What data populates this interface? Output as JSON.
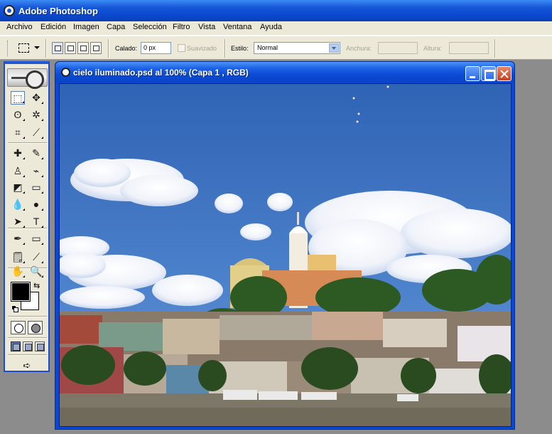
{
  "app": {
    "title": "Adobe Photoshop"
  },
  "menu": {
    "items": [
      "Archivo",
      "Edición",
      "Imagen",
      "Capa",
      "Selección",
      "Filtro",
      "Vista",
      "Ventana",
      "Ayuda"
    ]
  },
  "options": {
    "feather_label": "Calado:",
    "feather_value": "0 px",
    "antialias_label": "Suavizado",
    "style_label": "Estilo:",
    "style_value": "Normal",
    "width_label": "Anchura:",
    "height_label": "Altura:"
  },
  "toolbox": {
    "tools": [
      {
        "name": "rectangular-marquee-tool",
        "glyph": "⬚",
        "selected": true
      },
      {
        "name": "move-tool",
        "glyph": "✥"
      },
      {
        "name": "lasso-tool",
        "glyph": "ʘ"
      },
      {
        "name": "magic-wand-tool",
        "glyph": "✲"
      },
      {
        "name": "crop-tool",
        "glyph": "⌗"
      },
      {
        "name": "slice-tool",
        "glyph": "⟋"
      },
      {
        "name": "healing-brush-tool",
        "glyph": "✚"
      },
      {
        "name": "brush-tool",
        "glyph": "✎"
      },
      {
        "name": "clone-stamp-tool",
        "glyph": "♙"
      },
      {
        "name": "history-brush-tool",
        "glyph": "⌁"
      },
      {
        "name": "eraser-tool",
        "glyph": "◩"
      },
      {
        "name": "gradient-tool",
        "glyph": "▭"
      },
      {
        "name": "blur-tool",
        "glyph": "💧"
      },
      {
        "name": "dodge-tool",
        "glyph": "●"
      },
      {
        "name": "path-selection-tool",
        "glyph": "➤"
      },
      {
        "name": "type-tool",
        "glyph": "T"
      },
      {
        "name": "pen-tool",
        "glyph": "✒"
      },
      {
        "name": "rectangle-tool",
        "glyph": "▭"
      },
      {
        "name": "notes-tool",
        "glyph": "🗒"
      },
      {
        "name": "eyedropper-tool",
        "glyph": "⟋"
      },
      {
        "name": "hand-tool",
        "glyph": "✋"
      },
      {
        "name": "zoom-tool",
        "glyph": "🔍"
      }
    ],
    "foreground_color": "#000000",
    "background_color": "#ffffff",
    "swap_glyph": "⇆",
    "jump_glyph": "➪"
  },
  "document": {
    "title": "cielo iluminado.psd al 100% (Capa 1 , RGB)"
  },
  "colors": {
    "xp_blue": "#0b46d4",
    "sky_top": "#2f63b4",
    "sky_bottom": "#5b8fd6"
  }
}
